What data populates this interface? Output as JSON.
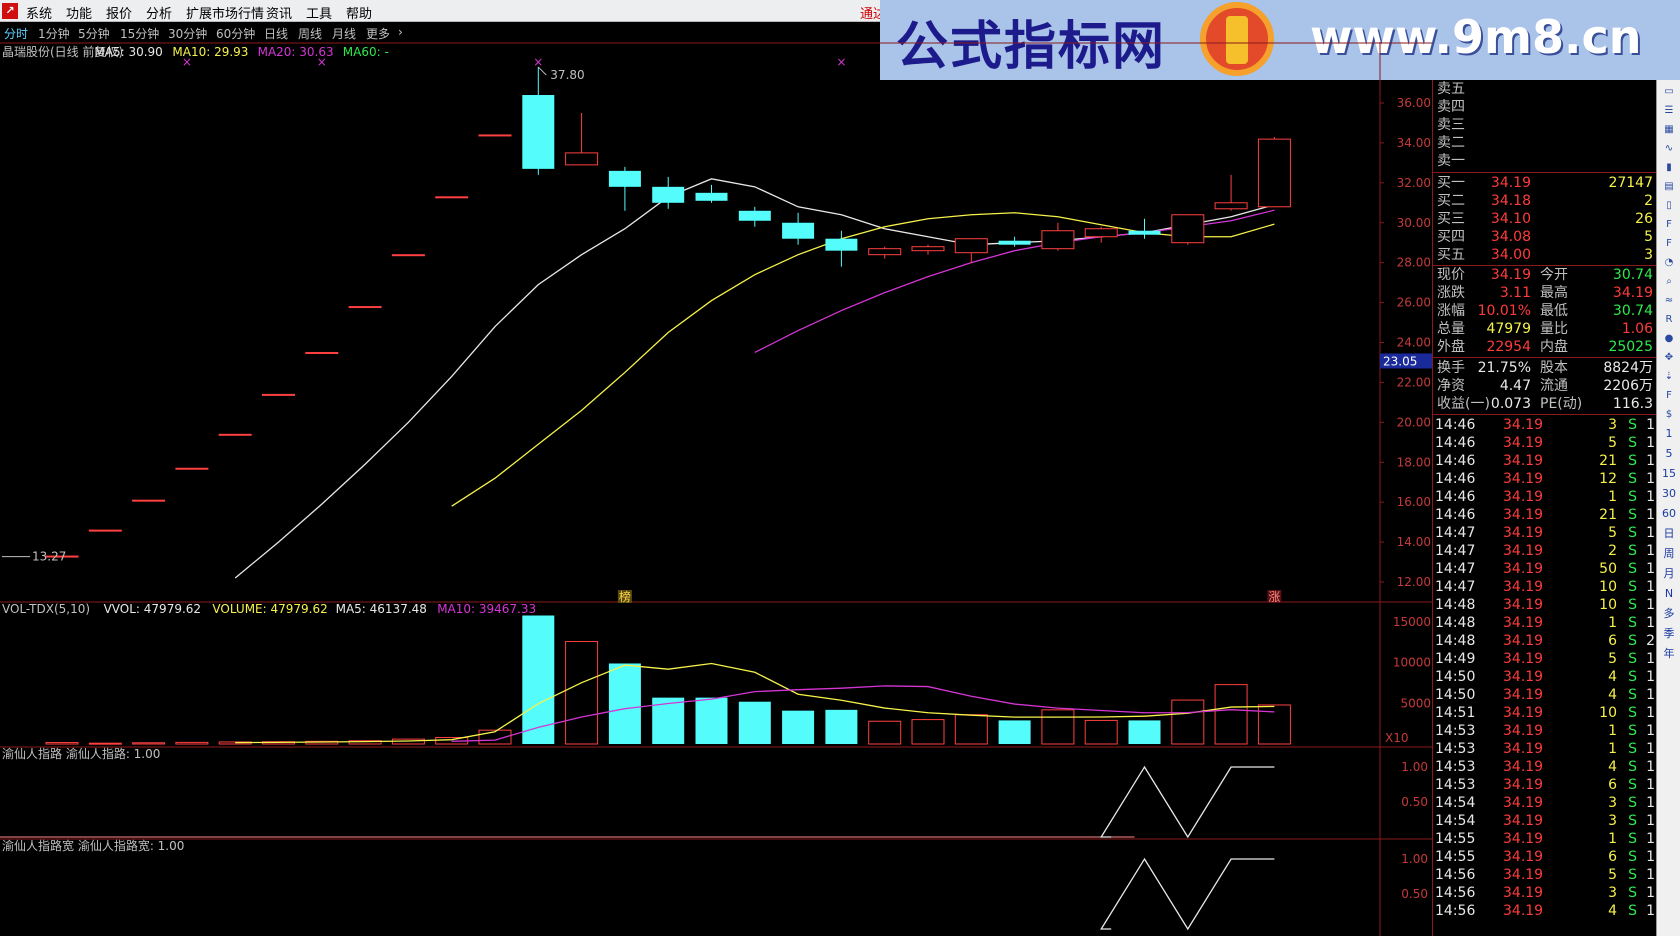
{
  "menu": [
    "系统",
    "功能",
    "报价",
    "分析",
    "扩展市场行情",
    "资讯",
    "工具",
    "帮助"
  ],
  "connect_label": "通达",
  "tabs": [
    "分时",
    "1分钟",
    "5分钟",
    "15分钟",
    "30分钟",
    "60分钟",
    "日线",
    "周线",
    "月线",
    "更多"
  ],
  "banner": {
    "text": "公式指标网",
    "url": "www.9m8.cn"
  },
  "main_legend": [
    {
      "text": "晶瑞股份(日线 前复权)",
      "color": "#c0c0c0"
    },
    {
      "text": "MA5: 30.90",
      "color": "#e8e8e8"
    },
    {
      "text": "MA10: 29.93",
      "color": "#f6f24a"
    },
    {
      "text": "MA20: 30.63",
      "color": "#d535d5"
    },
    {
      "text": "MA60: -",
      "color": "#2ee94b"
    }
  ],
  "vol_legend": [
    {
      "text": "VOL-TDX(5,10)",
      "color": "#c0c0c0"
    },
    {
      "text": "VVOL: 47979.62",
      "color": "#e8e8e8"
    },
    {
      "text": "VOLUME: 47979.62",
      "color": "#f6f24a"
    },
    {
      "text": "MA5: 46137.48",
      "color": "#e8e8e8"
    },
    {
      "text": "MA10: 39467.33",
      "color": "#d535d5"
    }
  ],
  "ind1_legend": [
    "渝仙人指路",
    "渝仙人指路: 1.00"
  ],
  "ind2_legend": [
    "渝仙人指路宽",
    "渝仙人指路宽: 1.00"
  ],
  "price_axis": [
    "36.00",
    "34.00",
    "32.00",
    "30.00",
    "28.00",
    "26.00",
    "24.00",
    "22.00",
    "20.00",
    "18.00",
    "16.00",
    "14.00",
    "12.00"
  ],
  "price_axis_vals": [
    36,
    34,
    32,
    30,
    28,
    26,
    24,
    22,
    20,
    18,
    16,
    14,
    12
  ],
  "vol_axis": [
    "15000",
    "10000",
    "5000"
  ],
  "vol_axis_vals": [
    15000,
    10000,
    5000
  ],
  "vol_unit": "X10",
  "ind_axis": [
    "1.00",
    "0.50"
  ],
  "ind_axis_vals": [
    1.0,
    0.5
  ],
  "current_price_marker": "23.05",
  "high_label": "37.80",
  "low_label": "13.27",
  "badge_bang": "榜",
  "badge_zhang": "涨",
  "chart_data": {
    "type": "candlestick",
    "candles": [
      {
        "o": 13.3,
        "h": 13.3,
        "l": 13.27,
        "c": 13.3
      },
      {
        "o": 14.6,
        "h": 14.6,
        "l": 14.6,
        "c": 14.6
      },
      {
        "o": 16.1,
        "h": 16.1,
        "l": 16.1,
        "c": 16.1
      },
      {
        "o": 17.7,
        "h": 17.7,
        "l": 17.7,
        "c": 17.7
      },
      {
        "o": 19.4,
        "h": 19.4,
        "l": 19.4,
        "c": 19.4
      },
      {
        "o": 21.4,
        "h": 21.4,
        "l": 21.4,
        "c": 21.4
      },
      {
        "o": 23.5,
        "h": 23.5,
        "l": 23.5,
        "c": 23.5
      },
      {
        "o": 25.8,
        "h": 25.8,
        "l": 25.8,
        "c": 25.8
      },
      {
        "o": 28.4,
        "h": 28.4,
        "l": 28.4,
        "c": 28.4
      },
      {
        "o": 31.3,
        "h": 31.3,
        "l": 31.3,
        "c": 31.3
      },
      {
        "o": 34.4,
        "h": 34.4,
        "l": 34.4,
        "c": 34.4
      },
      {
        "o": 36.4,
        "h": 37.8,
        "l": 32.4,
        "c": 32.7
      },
      {
        "o": 32.9,
        "h": 35.5,
        "l": 32.9,
        "c": 33.5
      },
      {
        "o": 32.6,
        "h": 32.8,
        "l": 30.6,
        "c": 31.8
      },
      {
        "o": 31.8,
        "h": 32.3,
        "l": 30.7,
        "c": 31.0
      },
      {
        "o": 31.5,
        "h": 31.9,
        "l": 31.0,
        "c": 31.1
      },
      {
        "o": 30.6,
        "h": 30.8,
        "l": 29.8,
        "c": 30.1
      },
      {
        "o": 30.0,
        "h": 30.5,
        "l": 28.9,
        "c": 29.2
      },
      {
        "o": 29.2,
        "h": 29.6,
        "l": 27.8,
        "c": 28.6
      },
      {
        "o": 28.4,
        "h": 28.8,
        "l": 28.2,
        "c": 28.7
      },
      {
        "o": 28.6,
        "h": 28.9,
        "l": 28.4,
        "c": 28.8
      },
      {
        "o": 28.5,
        "h": 29.2,
        "l": 28.0,
        "c": 29.2
      },
      {
        "o": 29.1,
        "h": 29.3,
        "l": 28.8,
        "c": 28.9
      },
      {
        "o": 28.7,
        "h": 30.0,
        "l": 28.6,
        "c": 29.6
      },
      {
        "o": 29.3,
        "h": 29.8,
        "l": 29.0,
        "c": 29.7
      },
      {
        "o": 29.6,
        "h": 30.2,
        "l": 29.2,
        "c": 29.4
      },
      {
        "o": 29.0,
        "h": 30.4,
        "l": 28.9,
        "c": 30.4
      },
      {
        "o": 30.7,
        "h": 32.4,
        "l": 30.6,
        "c": 31.0
      },
      {
        "o": 30.8,
        "h": 34.3,
        "l": 30.8,
        "c": 34.19
      }
    ],
    "ma5": [
      null,
      null,
      null,
      null,
      12.2,
      14.0,
      15.9,
      17.9,
      20.0,
      22.3,
      24.8,
      26.9,
      28.4,
      29.7,
      31.3,
      32.2,
      31.8,
      30.8,
      30.4,
      29.7,
      29.3,
      28.9,
      29.0,
      29.1,
      29.3,
      29.5,
      29.9,
      30.3,
      30.9
    ],
    "ma10": [
      null,
      null,
      null,
      null,
      null,
      null,
      null,
      null,
      null,
      15.8,
      17.2,
      18.9,
      20.6,
      22.5,
      24.5,
      26.1,
      27.4,
      28.4,
      29.2,
      29.8,
      30.2,
      30.4,
      30.5,
      30.3,
      29.9,
      29.5,
      29.3,
      29.3,
      29.93
    ],
    "ma20": [
      null,
      null,
      null,
      null,
      null,
      null,
      null,
      null,
      null,
      null,
      null,
      null,
      null,
      null,
      null,
      null,
      23.5,
      24.6,
      25.6,
      26.5,
      27.3,
      28.0,
      28.6,
      29.0,
      29.3,
      29.5,
      29.8,
      30.1,
      30.63
    ],
    "volume": [
      180,
      100,
      150,
      200,
      250,
      280,
      330,
      400,
      600,
      800,
      1700,
      15800,
      12600,
      9900,
      5700,
      5700,
      5200,
      4100,
      4200,
      2800,
      3000,
      3600,
      2900,
      4200,
      2900,
      2900,
      5400,
      7300,
      47979.62
    ],
    "vol_ma5": [
      null,
      null,
      null,
      null,
      176,
      196,
      242,
      292,
      372,
      530,
      1510,
      4960,
      7540,
      9700,
      9200,
      9900,
      8820,
      6120,
      5380,
      4420,
      3840,
      3540,
      3300,
      3300,
      3320,
      3420,
      3780,
      4540,
      4614
    ],
    "vol_ma10": [
      null,
      null,
      null,
      null,
      null,
      null,
      null,
      null,
      null,
      329,
      481,
      2050,
      3320,
      4340,
      4980,
      5520,
      6440,
      6680,
      6860,
      7150,
      7060,
      5870,
      4910,
      4410,
      4120,
      3840,
      3860,
      4220,
      3947
    ],
    "ind_signal": [
      0,
      0,
      0,
      0,
      0,
      0,
      0,
      0,
      0,
      0,
      0,
      0,
      0,
      0,
      0,
      0,
      0,
      0,
      0,
      0,
      0,
      0,
      0,
      0,
      0,
      1,
      0,
      1,
      1
    ],
    "price_ylim": [
      12,
      36
    ],
    "vol_ylim": [
      0,
      15000
    ]
  },
  "quote": {
    "sells": [
      {
        "label": "卖五",
        "price": "",
        "vol": ""
      },
      {
        "label": "卖四",
        "price": "",
        "vol": ""
      },
      {
        "label": "卖三",
        "price": "",
        "vol": ""
      },
      {
        "label": "卖二",
        "price": "",
        "vol": ""
      },
      {
        "label": "卖一",
        "price": "",
        "vol": ""
      }
    ],
    "buys": [
      {
        "label": "买一",
        "price": "34.19",
        "vol": "27147"
      },
      {
        "label": "买二",
        "price": "34.18",
        "vol": "2"
      },
      {
        "label": "买三",
        "price": "34.10",
        "vol": "26"
      },
      {
        "label": "买四",
        "price": "34.08",
        "vol": "5"
      },
      {
        "label": "买五",
        "price": "34.00",
        "vol": "3"
      }
    ],
    "stats": [
      {
        "l1": "现价",
        "v1": "34.19",
        "c1": "red",
        "l2": "今开",
        "v2": "30.74",
        "c2": "green"
      },
      {
        "l1": "涨跌",
        "v1": "3.11",
        "c1": "red",
        "l2": "最高",
        "v2": "34.19",
        "c2": "red"
      },
      {
        "l1": "涨幅",
        "v1": "10.01%",
        "c1": "red",
        "l2": "最低",
        "v2": "30.74",
        "c2": "green"
      },
      {
        "l1": "总量",
        "v1": "47979",
        "c1": "yellow",
        "l2": "量比",
        "v2": "1.06",
        "c2": "red"
      },
      {
        "l1": "外盘",
        "v1": "22954",
        "c1": "red",
        "l2": "内盘",
        "v2": "25025",
        "c2": "green"
      }
    ],
    "stats2": [
      {
        "l1": "换手",
        "v1": "21.75%",
        "l2": "股本",
        "v2": "8824万"
      },
      {
        "l1": "净资",
        "v1": "4.47",
        "l2": "流通",
        "v2": "2206万"
      },
      {
        "l1": "收益(一)",
        "v1": "0.073",
        "l2": "PE(动)",
        "v2": "116.3"
      }
    ],
    "ticks": [
      {
        "t": "14:46",
        "p": "34.19",
        "q": "3",
        "s": "S",
        "c": "1"
      },
      {
        "t": "14:46",
        "p": "34.19",
        "q": "5",
        "s": "S",
        "c": "1"
      },
      {
        "t": "14:46",
        "p": "34.19",
        "q": "21",
        "s": "S",
        "c": "1"
      },
      {
        "t": "14:46",
        "p": "34.19",
        "q": "12",
        "s": "S",
        "c": "1"
      },
      {
        "t": "14:46",
        "p": "34.19",
        "q": "1",
        "s": "S",
        "c": "1"
      },
      {
        "t": "14:46",
        "p": "34.19",
        "q": "21",
        "s": "S",
        "c": "1"
      },
      {
        "t": "14:47",
        "p": "34.19",
        "q": "5",
        "s": "S",
        "c": "1"
      },
      {
        "t": "14:47",
        "p": "34.19",
        "q": "2",
        "s": "S",
        "c": "1"
      },
      {
        "t": "14:47",
        "p": "34.19",
        "q": "50",
        "s": "S",
        "c": "1"
      },
      {
        "t": "14:47",
        "p": "34.19",
        "q": "10",
        "s": "S",
        "c": "1"
      },
      {
        "t": "14:48",
        "p": "34.19",
        "q": "10",
        "s": "S",
        "c": "1"
      },
      {
        "t": "14:48",
        "p": "34.19",
        "q": "1",
        "s": "S",
        "c": "1"
      },
      {
        "t": "14:48",
        "p": "34.19",
        "q": "6",
        "s": "S",
        "c": "2"
      },
      {
        "t": "14:49",
        "p": "34.19",
        "q": "5",
        "s": "S",
        "c": "1"
      },
      {
        "t": "14:50",
        "p": "34.19",
        "q": "4",
        "s": "S",
        "c": "1"
      },
      {
        "t": "14:50",
        "p": "34.19",
        "q": "4",
        "s": "S",
        "c": "1"
      },
      {
        "t": "14:51",
        "p": "34.19",
        "q": "10",
        "s": "S",
        "c": "1"
      },
      {
        "t": "14:53",
        "p": "34.19",
        "q": "1",
        "s": "S",
        "c": "1"
      },
      {
        "t": "14:53",
        "p": "34.19",
        "q": "1",
        "s": "S",
        "c": "1"
      },
      {
        "t": "14:53",
        "p": "34.19",
        "q": "4",
        "s": "S",
        "c": "1"
      },
      {
        "t": "14:53",
        "p": "34.19",
        "q": "6",
        "s": "S",
        "c": "1"
      },
      {
        "t": "14:54",
        "p": "34.19",
        "q": "3",
        "s": "S",
        "c": "1"
      },
      {
        "t": "14:54",
        "p": "34.19",
        "q": "3",
        "s": "S",
        "c": "1"
      },
      {
        "t": "14:55",
        "p": "34.19",
        "q": "1",
        "s": "S",
        "c": "1"
      },
      {
        "t": "14:55",
        "p": "34.19",
        "q": "6",
        "s": "S",
        "c": "1"
      },
      {
        "t": "14:56",
        "p": "34.19",
        "q": "5",
        "s": "S",
        "c": "1"
      },
      {
        "t": "14:56",
        "p": "34.19",
        "q": "3",
        "s": "S",
        "c": "1"
      },
      {
        "t": "14:56",
        "p": "34.19",
        "q": "4",
        "s": "S",
        "c": "1"
      }
    ]
  },
  "toolbar_icons": [
    "window-icon",
    "list-icon",
    "grid-icon",
    "chart-line-icon",
    "candle-icon",
    "book-icon",
    "file-icon",
    "f10-icon",
    "fz-icon",
    "flow-icon",
    "search-icon",
    "wave-icon",
    "rsi-icon",
    "stop-icon",
    "nav-icon",
    "arrow-icon",
    "fs-icon",
    "money-icon"
  ],
  "toolbar_labels": [
    "1",
    "5",
    "15",
    "30",
    "60",
    "日",
    "周",
    "月",
    "N",
    "多",
    "季",
    "年"
  ]
}
